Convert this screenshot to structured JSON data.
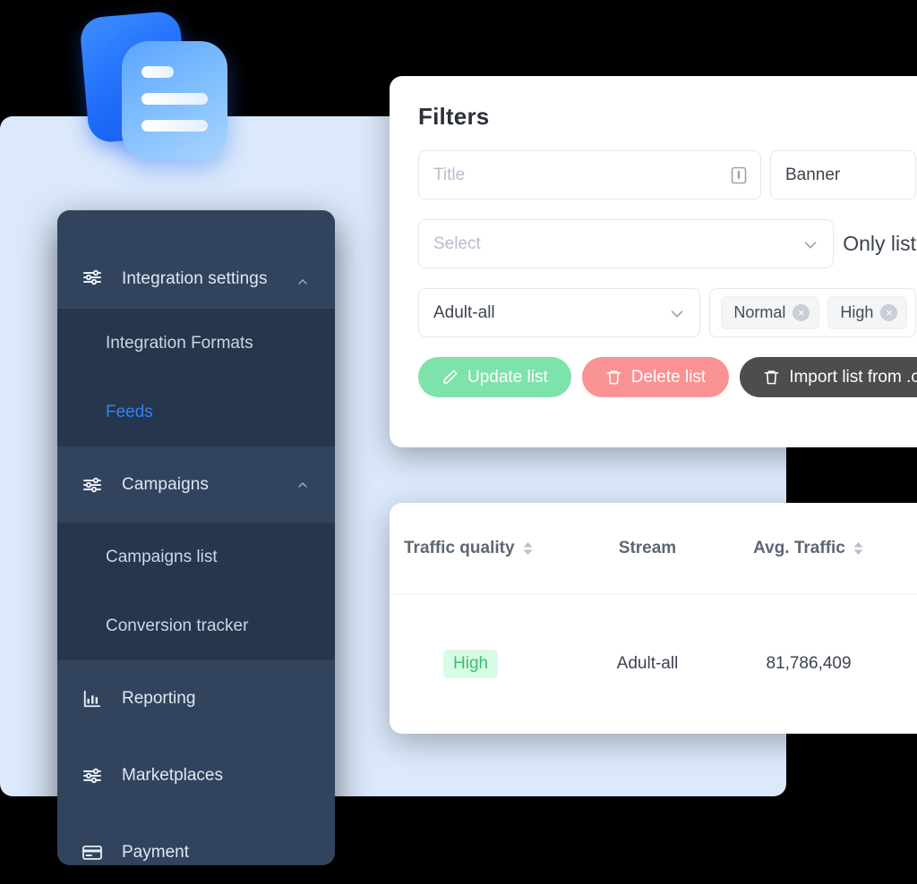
{
  "logo": {
    "name": "stacked-documents-logo"
  },
  "sidebar": {
    "groups": [
      {
        "label": "Integration settings",
        "icon": "sliders-icon",
        "caret": "chevron-up-icon",
        "expanded": true,
        "items": [
          {
            "label": "Integration Formats",
            "active": false
          },
          {
            "label": "Feeds",
            "active": true
          }
        ]
      },
      {
        "label": "Campaigns",
        "icon": "sliders-icon",
        "caret": "chevron-up-icon",
        "expanded": true,
        "items": [
          {
            "label": "Campaigns list",
            "active": false
          },
          {
            "label": "Conversion tracker",
            "active": false
          }
        ]
      }
    ],
    "items": [
      {
        "label": "Reporting",
        "icon": "bar-chart-icon"
      },
      {
        "label": "Marketplaces",
        "icon": "sliders-icon"
      },
      {
        "label": "Payment",
        "icon": "credit-card-icon"
      }
    ],
    "colors": {
      "bg": "#2e3f57",
      "submenu_bg": "#26364c",
      "active": "#2f83f6"
    }
  },
  "filters": {
    "title": "Filters",
    "title_input": {
      "placeholder": "Title",
      "value": "",
      "icon": "clipboard-icon"
    },
    "banner_field": {
      "value": "Banner"
    },
    "select_input": {
      "placeholder": "Select",
      "value": "",
      "icon": "chevron-down-icon"
    },
    "only_list_label": "Only list",
    "stream_select": {
      "value": "Adult-all",
      "icon": "chevron-down-icon"
    },
    "chips": [
      {
        "label": "Normal",
        "remove": "×"
      },
      {
        "label": "High",
        "remove": "×"
      }
    ],
    "buttons": [
      {
        "label": "Update list",
        "icon": "pencil-icon",
        "color": "#7ee2ab"
      },
      {
        "label": "Delete list",
        "icon": "trash-icon",
        "color": "#f99292"
      },
      {
        "label": "Import list from .csv",
        "icon": "trash-icon",
        "color": "#4d4d4d"
      }
    ]
  },
  "table": {
    "columns": [
      {
        "label": "Traffic quality",
        "sortable": true
      },
      {
        "label": "Stream",
        "sortable": false
      },
      {
        "label": "Avg. Traffic",
        "sortable": true
      }
    ],
    "rows": [
      {
        "quality": "High",
        "stream": "Adult-all",
        "avg_traffic": "81,786,409"
      }
    ],
    "badge_colors": {
      "high_bg": "#d9fbe6",
      "high_fg": "#39c06d"
    }
  },
  "theme": {
    "page_bg": "#000000",
    "backdrop": "#dbe9fb",
    "card_bg": "#ffffff"
  }
}
